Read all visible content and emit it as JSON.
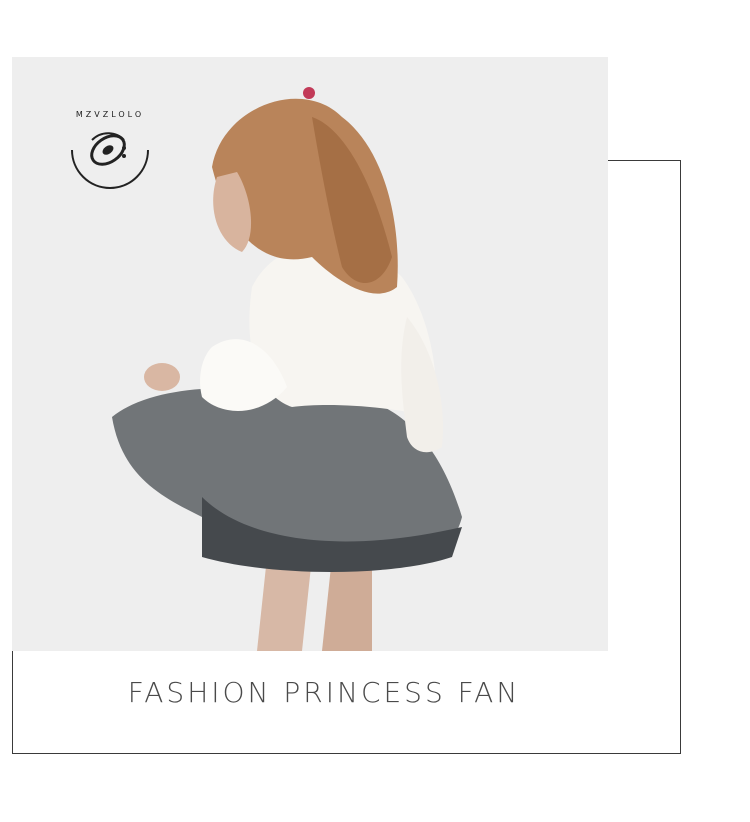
{
  "brand": {
    "logo_text": "MZVZLOLO",
    "logo_icon": "pacifier-logo-icon"
  },
  "hero": {
    "image_subject": "girl-in-white-blouse-and-grey-tutu-photo"
  },
  "caption": {
    "text": "FASHION PRINCESS FAN"
  }
}
